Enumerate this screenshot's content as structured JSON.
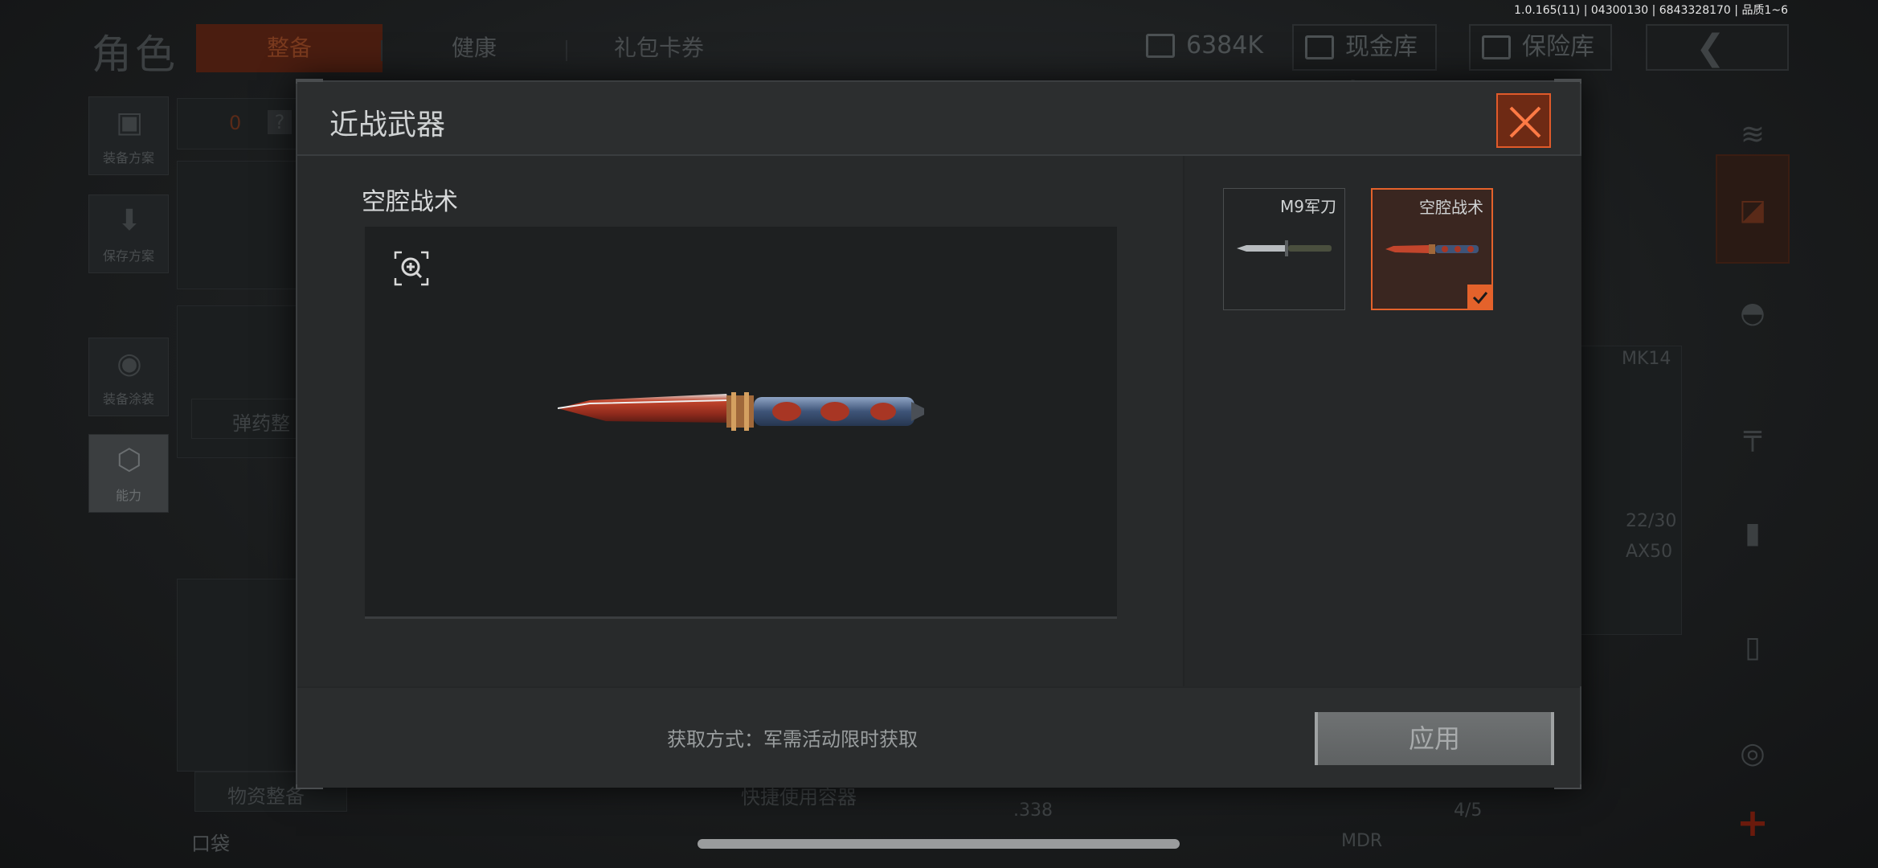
{
  "version_info": "1.0.165(11) | 04300130 | 6843328170 | 品质1~6",
  "header": {
    "page_title": "角色",
    "tabs": [
      {
        "label": "整备",
        "active": true
      },
      {
        "label": "健康",
        "active": false
      },
      {
        "label": "礼包卡券",
        "active": false
      }
    ],
    "resources": {
      "money": "6384K",
      "cash_vault": "现金库 0",
      "safe": "保险库"
    }
  },
  "left_menu": [
    {
      "label": "装备方案",
      "icon": "vest-icon"
    },
    {
      "label": "保存方案",
      "icon": "download-icon"
    },
    {
      "label": "装备涂装",
      "icon": "helmet-icon"
    },
    {
      "label": "能力",
      "icon": "ability-icon"
    }
  ],
  "background_panels": {
    "armor_count": "0",
    "help": "?",
    "ammo_button": "弹药整",
    "supplies_button": "物资整备",
    "quick_container": "快捷使用容器",
    "pocket": "口袋"
  },
  "background_weapons": [
    {
      "name": "MK14",
      "ammo": "22/30"
    },
    {
      "name": "AX50",
      "caliber": ".338",
      "ammo": "4/5"
    },
    {
      "name": "MDR"
    }
  ],
  "modal": {
    "title": "近战武器",
    "selected_item_name": "空腔战术",
    "skins": [
      {
        "name": "M9军刀",
        "selected": false
      },
      {
        "name": "空腔战术",
        "selected": true
      }
    ],
    "obtain_method": "获取方式：军需活动限时获取",
    "apply_label": "应用"
  },
  "colors": {
    "accent": "#e4622b",
    "close_bg": "#6e2a14"
  }
}
